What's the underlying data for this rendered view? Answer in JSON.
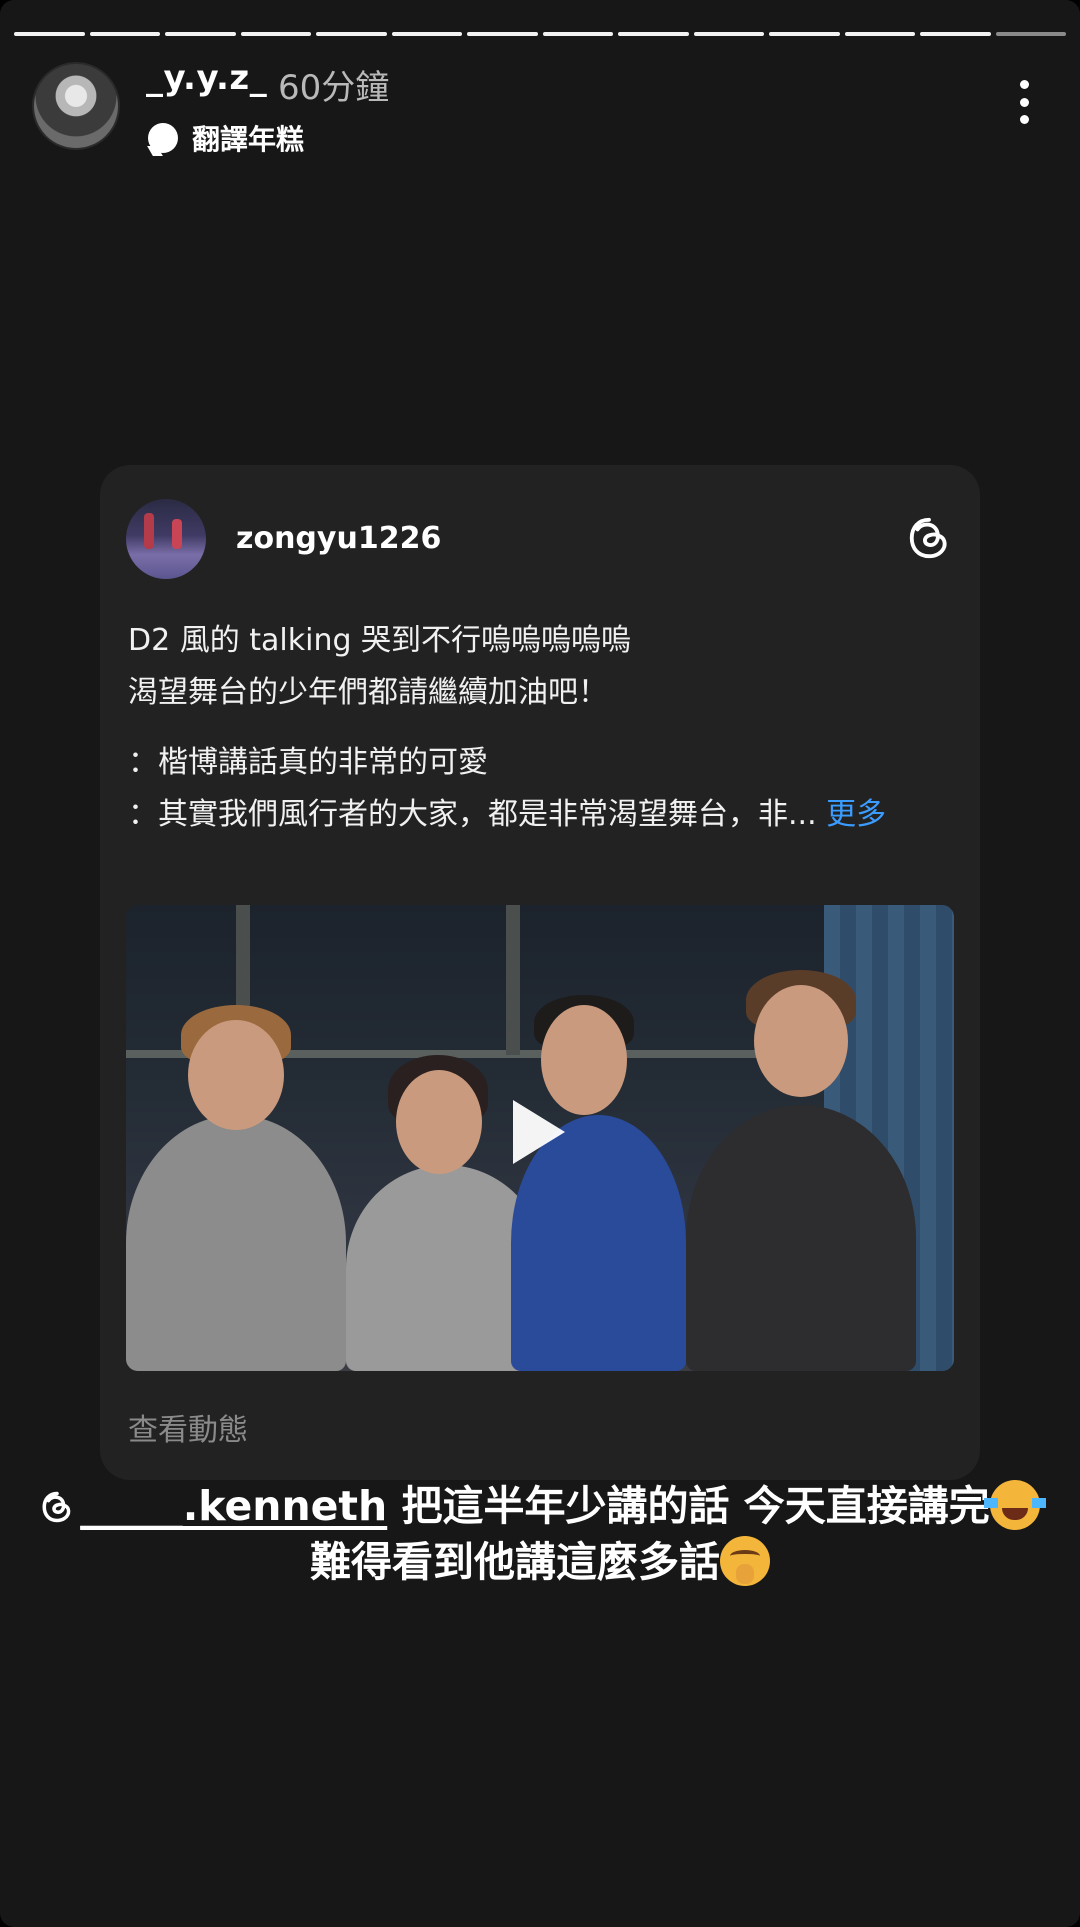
{
  "story": {
    "username": "_y.y.z_",
    "timestamp": "60分鐘",
    "sub_label": "翻譯年糕",
    "progress_segments_total": 14,
    "progress_segments_viewed": 13
  },
  "card": {
    "username": "zongyu1226",
    "line1": "D2 風的 talking 哭到不行嗚嗚嗚嗚嗚",
    "line2": "渴望舞台的少年們都請繼續加油吧！",
    "quote1": "：楷博講話真的非常的可愛",
    "quote2": "：其實我們風行者的大家，都是非常渴望舞台，非...",
    "more_label": "更多",
    "footer": "查看動態"
  },
  "caption": {
    "mention": "_____.kenneth",
    "line1_text": "把這半年少講的話 今天直接講完",
    "line2_text": "難得看到他講這麼多話"
  },
  "icons": {
    "bubble": "chat-bubble-icon",
    "more": "more-vertical-icon",
    "threads": "threads-logo-icon",
    "play": "play-icon"
  },
  "colors": {
    "background": "#171717",
    "card": "#222223",
    "link": "#3b9cff"
  }
}
